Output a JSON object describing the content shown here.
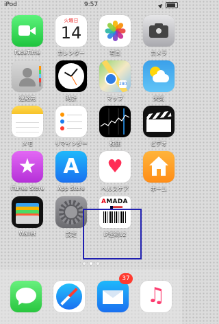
{
  "status_bar": {
    "carrier": "iPod",
    "time": "9:57"
  },
  "calendar": {
    "weekday": "火曜日",
    "day": "14"
  },
  "apps": {
    "facetime": "FaceTime",
    "calendar": "カレンダー",
    "photos": "写真",
    "camera": "カメラ",
    "contacts": "連絡先",
    "clock": "時計",
    "maps": "マップ",
    "weather": "天気",
    "notes": "メモ",
    "reminders": "リマインダー",
    "stocks": "株価",
    "videos": "ビデオ",
    "itunes": "iTunes Store",
    "appstore": "App Store",
    "health": "ヘルスケア",
    "home": "ホーム",
    "wallet": "Wallet",
    "settings": "設定",
    "ipad": "iP連続v2"
  },
  "ipad_icon": {
    "brand": "AMADA"
  },
  "dock": {
    "mail_badge": "37"
  },
  "colors": {
    "highlight": "#1f1fb0",
    "badge": "#ff3b30"
  }
}
